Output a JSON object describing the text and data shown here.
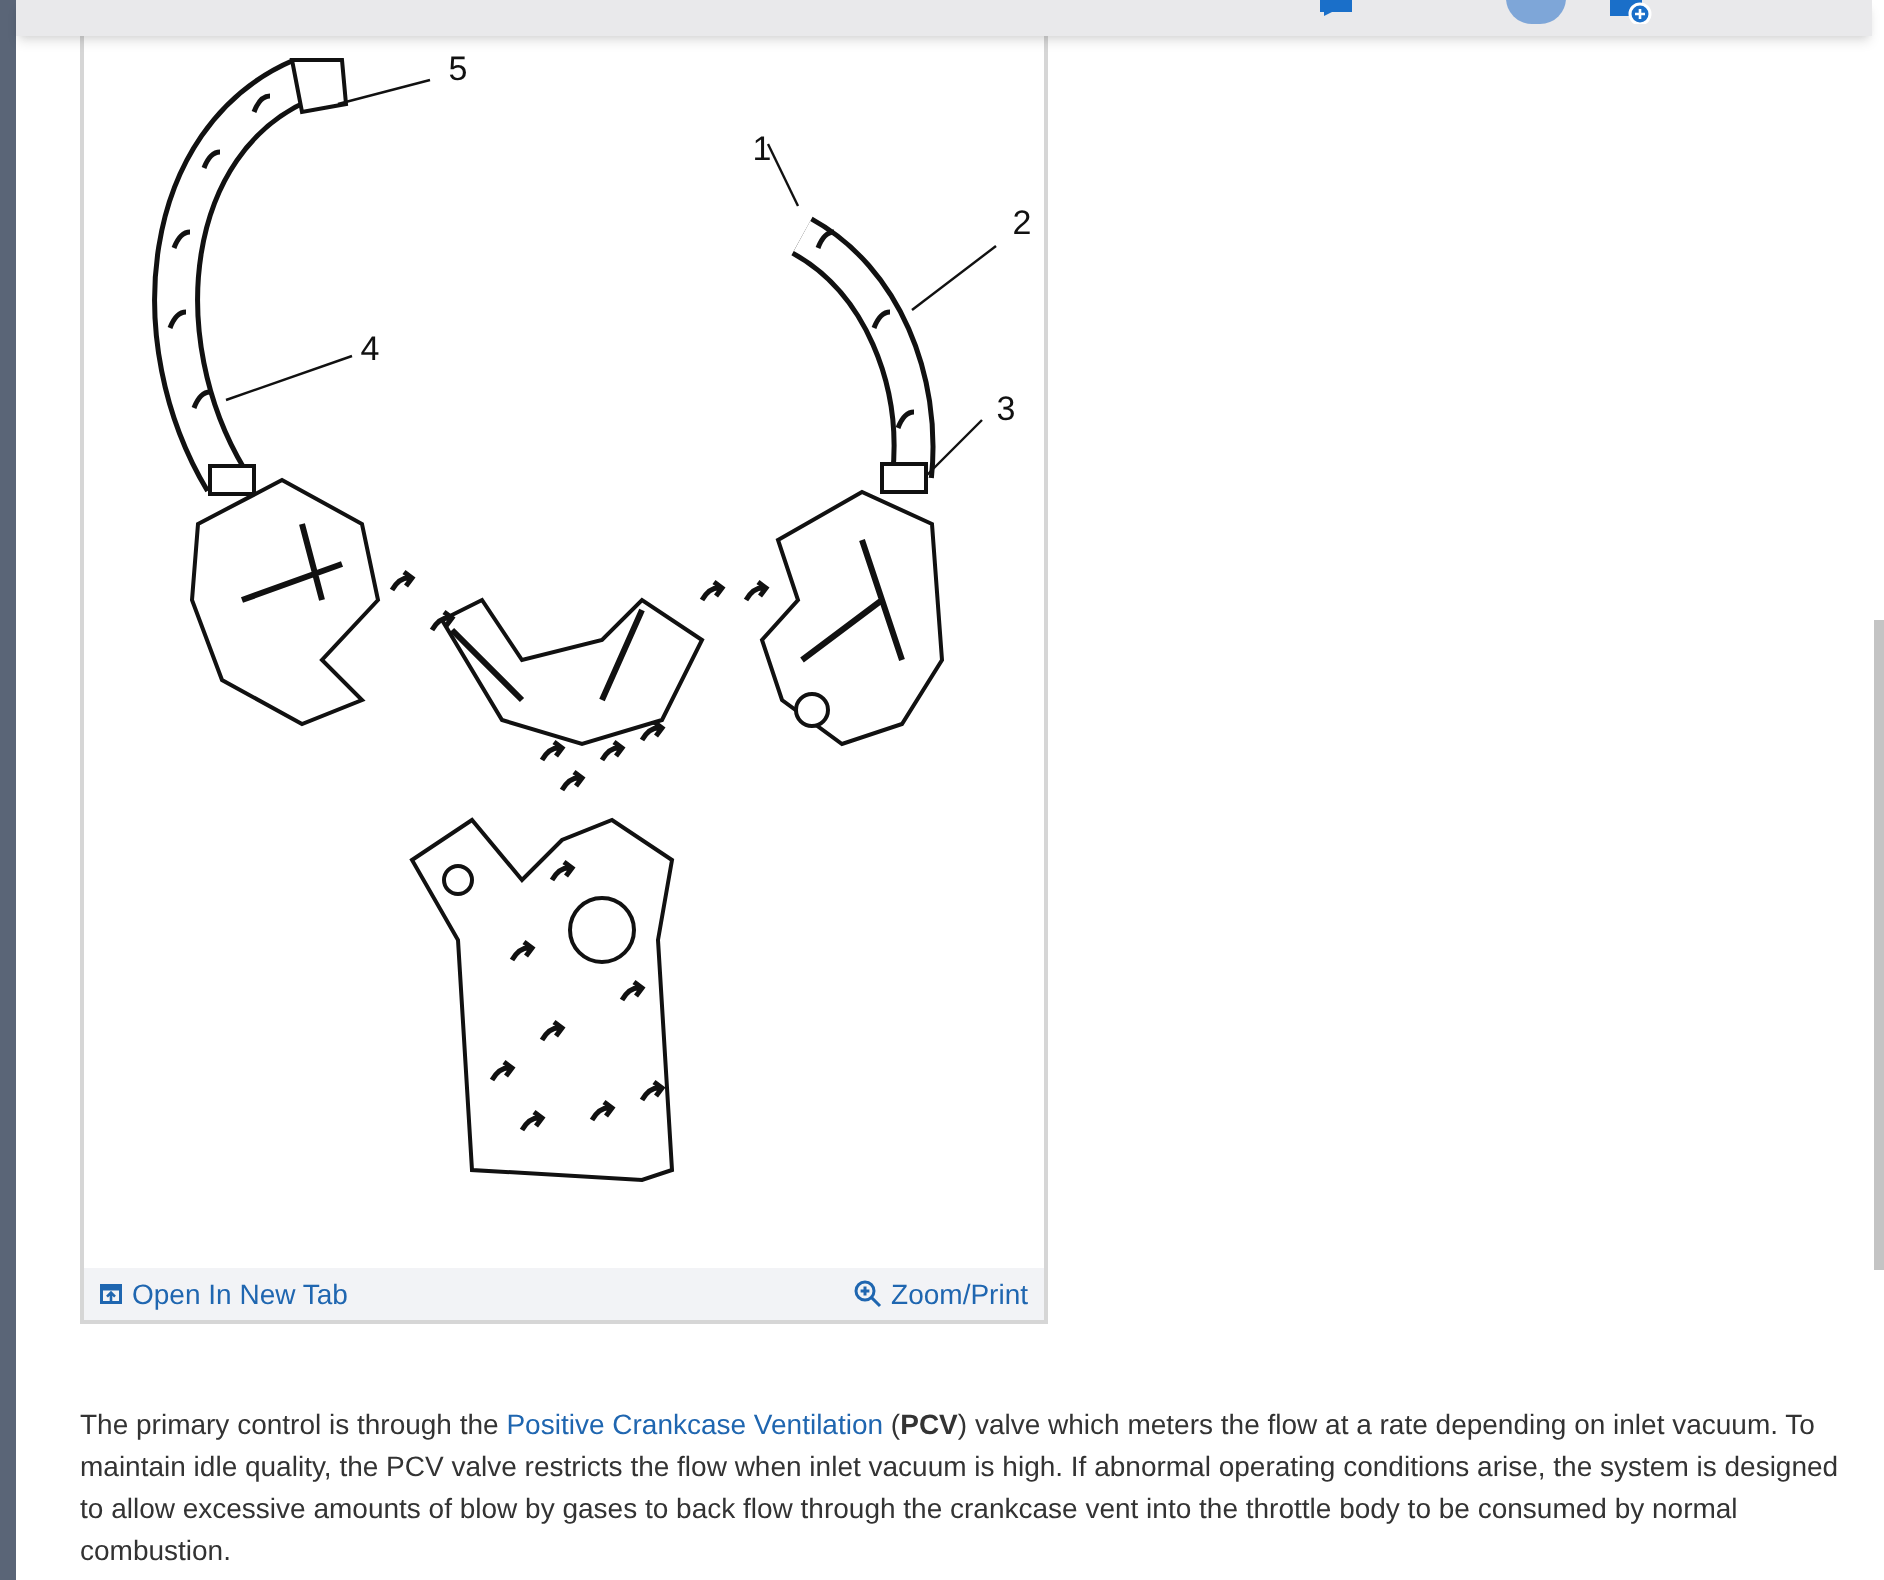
{
  "figure": {
    "callouts": [
      {
        "label": "1"
      },
      {
        "label": "2"
      },
      {
        "label": "3"
      },
      {
        "label": "4"
      },
      {
        "label": "5"
      }
    ],
    "actions": [
      {
        "kind": "open",
        "label": "Open In New Tab"
      },
      {
        "kind": "zoom",
        "label": "Zoom/Print"
      }
    ]
  },
  "paragraph": {
    "before": " The primary control is through the ",
    "link": "Positive Crankcase Ventilation",
    "after": " (**PCV**) valve which meters the flow at a rate depending on inlet vacuum. To maintain idle quality, the PCV valve restricts the flow when inlet vacuum is high. If abnormal operating conditions arise, the system is designed to allow excessive amounts of blow by gases to back flow through the crankcase vent into the throttle body to be consumed by normal combustion."
  }
}
